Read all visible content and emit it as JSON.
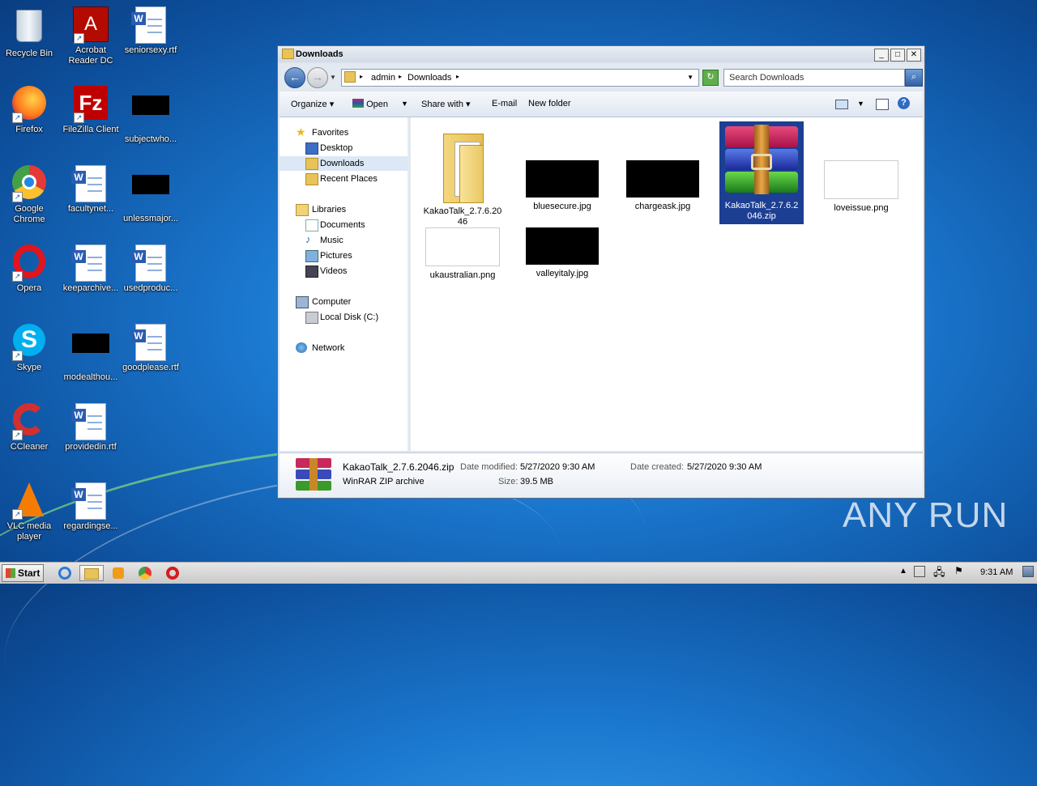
{
  "desktop": {
    "icons": [
      {
        "label": "Recycle Bin"
      },
      {
        "label": "Acrobat Reader DC"
      },
      {
        "label": "seniorsexy.rtf"
      },
      {
        "label": "Firefox"
      },
      {
        "label": "FileZilla Client"
      },
      {
        "label": "subjectwho..."
      },
      {
        "label": "Google Chrome"
      },
      {
        "label": "facultynet..."
      },
      {
        "label": "unlessmajor..."
      },
      {
        "label": "Opera"
      },
      {
        "label": "keeparchive..."
      },
      {
        "label": "usedproduc..."
      },
      {
        "label": "Skype"
      },
      {
        "label": "modealthou..."
      },
      {
        "label": "goodplease.rtf"
      },
      {
        "label": "CCleaner"
      },
      {
        "label": "providedin.rtf"
      },
      {
        "label": "VLC media player"
      },
      {
        "label": "regardingse..."
      }
    ]
  },
  "window": {
    "title": "Downloads",
    "breadcrumb": [
      "admin",
      "Downloads"
    ],
    "search_placeholder": "Search Downloads",
    "toolbar": {
      "organize": "Organize",
      "open": "Open",
      "share_with": "Share with",
      "email": "E-mail",
      "new_folder": "New folder"
    },
    "nav": {
      "favorites": "Favorites",
      "desktop": "Desktop",
      "downloads": "Downloads",
      "recent": "Recent Places",
      "libraries": "Libraries",
      "documents": "Documents",
      "music": "Music",
      "pictures": "Pictures",
      "videos": "Videos",
      "computer": "Computer",
      "local_disk": "Local Disk (C:)",
      "network": "Network"
    },
    "files": [
      {
        "name": "KakaoTalk_2.7.6.2046",
        "kind": "folder"
      },
      {
        "name": "bluesecure.jpg",
        "kind": "black"
      },
      {
        "name": "chargeask.jpg",
        "kind": "black"
      },
      {
        "name": "KakaoTalk_2.7.6.2046.zip",
        "kind": "rar",
        "selected": true
      },
      {
        "name": "loveissue.png",
        "kind": "white"
      },
      {
        "name": "ukaustralian.png",
        "kind": "white"
      },
      {
        "name": "valleyitaly.jpg",
        "kind": "black"
      }
    ],
    "details": {
      "name": "KakaoTalk_2.7.6.2046.zip",
      "type": "WinRAR ZIP archive",
      "modified_label": "Date modified:",
      "modified": "5/27/2020 9:30 AM",
      "created_label": "Date created:",
      "created": "5/27/2020 9:30 AM",
      "size_label": "Size:",
      "size": "39.5 MB"
    }
  },
  "taskbar": {
    "start": "Start",
    "clock": "9:31 AM"
  },
  "watermark": "ANY RUN"
}
